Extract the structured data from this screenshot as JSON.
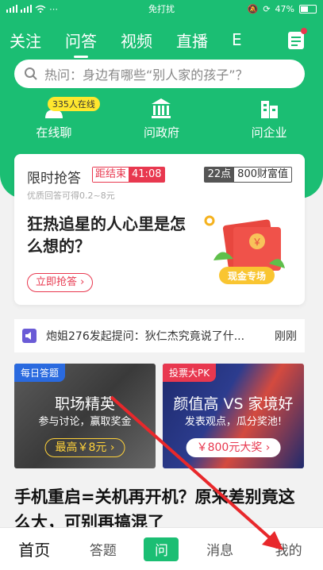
{
  "status_bar": {
    "mode": "免打扰",
    "battery": "47%"
  },
  "top_nav": {
    "tabs": [
      "关注",
      "问答",
      "视频",
      "直播",
      "E"
    ],
    "active_index": 1
  },
  "search": {
    "placeholder": "热问：身边有哪些“别人家的孩子”？"
  },
  "quick_actions": [
    {
      "label": "在线聊",
      "badge": "335人在线",
      "icon": "person-chat-icon"
    },
    {
      "label": "问政府",
      "icon": "government-icon"
    },
    {
      "label": "问企业",
      "icon": "enterprise-icon"
    }
  ],
  "flash_card": {
    "title": "限时抢答",
    "countdown_label": "距结束",
    "countdown_time": "41:08",
    "wealth_time": "22点",
    "wealth_value": "800财富值",
    "subtitle": "优质回答可得0.2~8元",
    "question": "狂热追星的人心里是怎么想的？",
    "button": "立即抢答 ›",
    "packet_label": "现金专场",
    "packet_symbol": "￥"
  },
  "ticker": {
    "text": "炮姐276发起提问：狄仁杰究竟说了什...",
    "time": "刚刚"
  },
  "tiles": [
    {
      "tag": "每日答题",
      "title": "职场精英",
      "desc": "参与讨论，赢取奖金",
      "button": "最高￥8元 ›"
    },
    {
      "tag": "投票大PK",
      "title": "颜值高 VS 家境好",
      "desc": "发表观点，瓜分奖池!",
      "button": "￥800元大奖 ›"
    }
  ],
  "article": {
    "title": "手机重启=关机再开机？原来差别竟这么大，可别再搞混了"
  },
  "bottom_nav": {
    "items": [
      "首页",
      "答题",
      "问",
      "消息",
      "我的"
    ],
    "active_index": 0
  },
  "colors": {
    "brand_green": "#1bbe73",
    "accent_red": "#e8384f",
    "annotation_arrow": "#e8282b"
  }
}
